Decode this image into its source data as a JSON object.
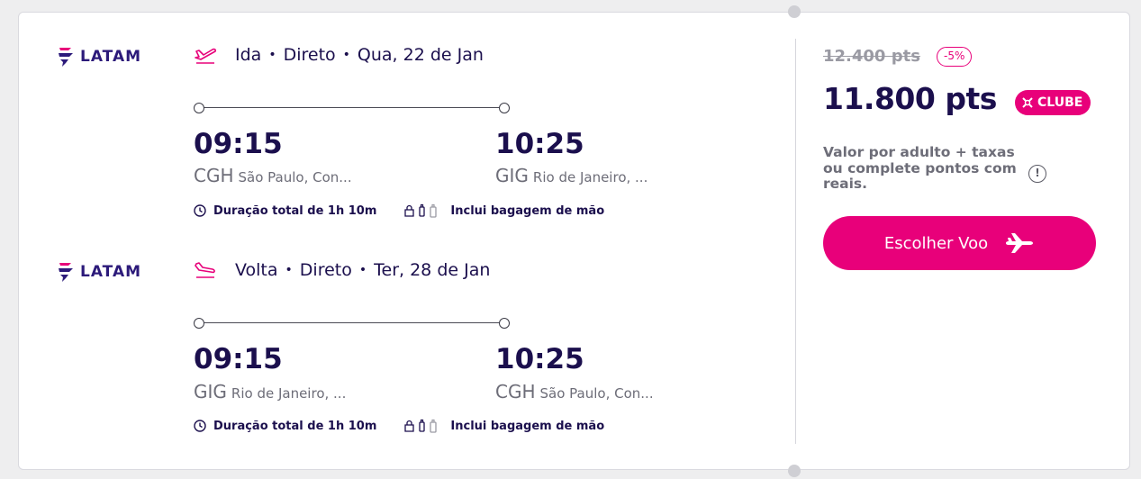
{
  "legs": [
    {
      "airline": "LATAM",
      "direction": "Ida",
      "type": "Direto",
      "date": "Qua, 22 de Jan",
      "depart_time": "09:15",
      "depart_code": "CGH",
      "depart_city": "São Paulo, Con...",
      "arrive_time": "10:25",
      "arrive_code": "GIG",
      "arrive_city": "Rio de Janeiro, ...",
      "duration": "Duração total de 1h 10m",
      "baggage": "Inclui bagagem de mão"
    },
    {
      "airline": "LATAM",
      "direction": "Volta",
      "type": "Direto",
      "date": "Ter, 28 de Jan",
      "depart_time": "09:15",
      "depart_code": "GIG",
      "depart_city": "Rio de Janeiro, ...",
      "arrive_time": "10:25",
      "arrive_code": "CGH",
      "arrive_city": "São Paulo, Con...",
      "duration": "Duração total de 1h 10m",
      "baggage": "Inclui bagagem de mão"
    }
  ],
  "pricing": {
    "old_price": "12.400 pts",
    "discount": "-5%",
    "price": "11.800 pts",
    "club_badge": "CLUBE",
    "note_line1": "Valor por adulto + taxas",
    "note_line2": "ou complete pontos com",
    "note_line3": "reais.",
    "button_label": "Escolher Voo"
  },
  "icons": {
    "airline_logo": "latam-logo",
    "departure": "plane-takeoff-icon",
    "arrival": "plane-landing-icon",
    "clock": "clock-icon",
    "baggage": "luggage-icon",
    "info": "info-icon",
    "button": "airplane-icon"
  },
  "colors": {
    "accent": "#e8007a",
    "navy": "#1b0f4d",
    "brand": "#2c1a7a",
    "muted": "#6d6d78"
  }
}
